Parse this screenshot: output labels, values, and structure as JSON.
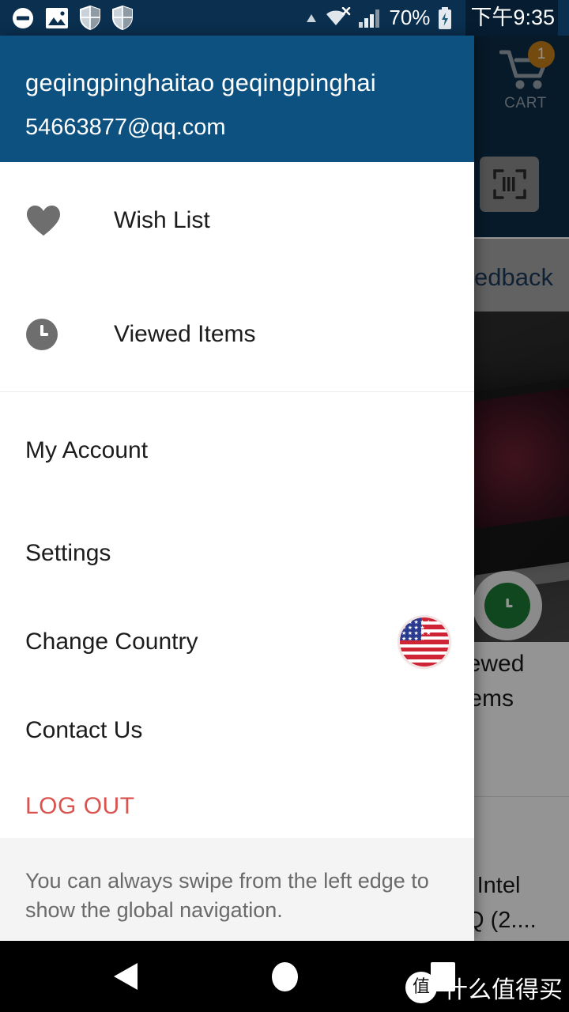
{
  "status_bar": {
    "notification_icons": [
      "do-not-disturb-icon",
      "image-icon",
      "shield-icon",
      "shield-icon"
    ],
    "triangle_icon": "triangle-up-icon",
    "wifi_icon": "wifi-disconnected-icon",
    "signal_icon": "cellular-signal-icon",
    "battery_percent": "70%",
    "battery_icon": "battery-charging-icon",
    "time": "下午9:35"
  },
  "drawer": {
    "account": {
      "name": "geqingpinghaitao geqingpinghai",
      "email": "54663877@qq.com"
    },
    "primary_items": [
      {
        "label": "Wish List",
        "icon": "heart-icon"
      },
      {
        "label": "Viewed Items",
        "icon": "clock-icon"
      }
    ],
    "secondary_items": [
      {
        "label": "My Account",
        "trailing": ""
      },
      {
        "label": "Settings",
        "trailing": ""
      },
      {
        "label": "Change Country",
        "trailing": "us-flag-icon"
      },
      {
        "label": "Contact Us",
        "trailing": ""
      }
    ],
    "logout_label": "LOG OUT",
    "hint_text": "You can always swipe from the left edge to show the global navigation."
  },
  "background_app": {
    "cart_label": "CART",
    "cart_badge": "1",
    "scan_icon": "barcode-scan-icon",
    "feedback_text": "edback",
    "viewed_items_text": "iewed\ntems",
    "viewed_icon": "clock-icon",
    "product_text": "' Intel\nQ (2...."
  },
  "nav_bar": {
    "back": "back-triangle-icon",
    "home": "home-circle-icon",
    "recents": "recents-square-icon",
    "watermark_badge": "值",
    "watermark_text": "什么值得买"
  },
  "colors": {
    "status_bar": "#0a2f4f",
    "drawer_header": "#0d5180",
    "app_bar": "#0d2d47",
    "logout": "#d9534f",
    "cart_badge": "#c9801a",
    "hint_bg": "#f4f4f4"
  }
}
